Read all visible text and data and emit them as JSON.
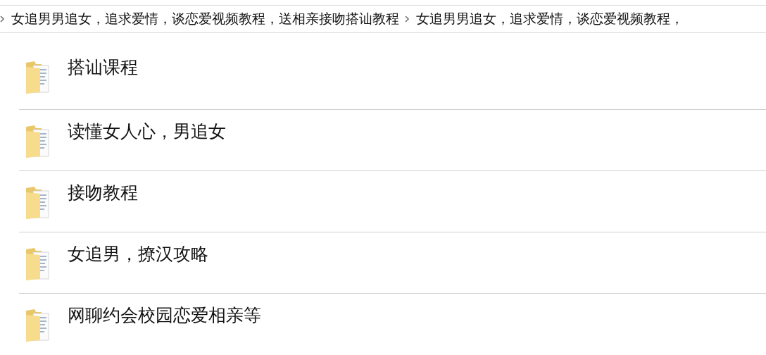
{
  "breadcrumb": [
    {
      "label": "女追男男追女，追求爱情，谈恋爱视频教程，送相亲接吻搭讪教程"
    },
    {
      "label": "女追男男追女，追求爱情，谈恋爱视频教程，"
    }
  ],
  "items": [
    {
      "name": "搭讪课程"
    },
    {
      "name": "读懂女人心，男追女"
    },
    {
      "name": "接吻教程"
    },
    {
      "name": "女追男，撩汉攻略"
    },
    {
      "name": "网聊约会校园恋爱相亲等"
    }
  ]
}
